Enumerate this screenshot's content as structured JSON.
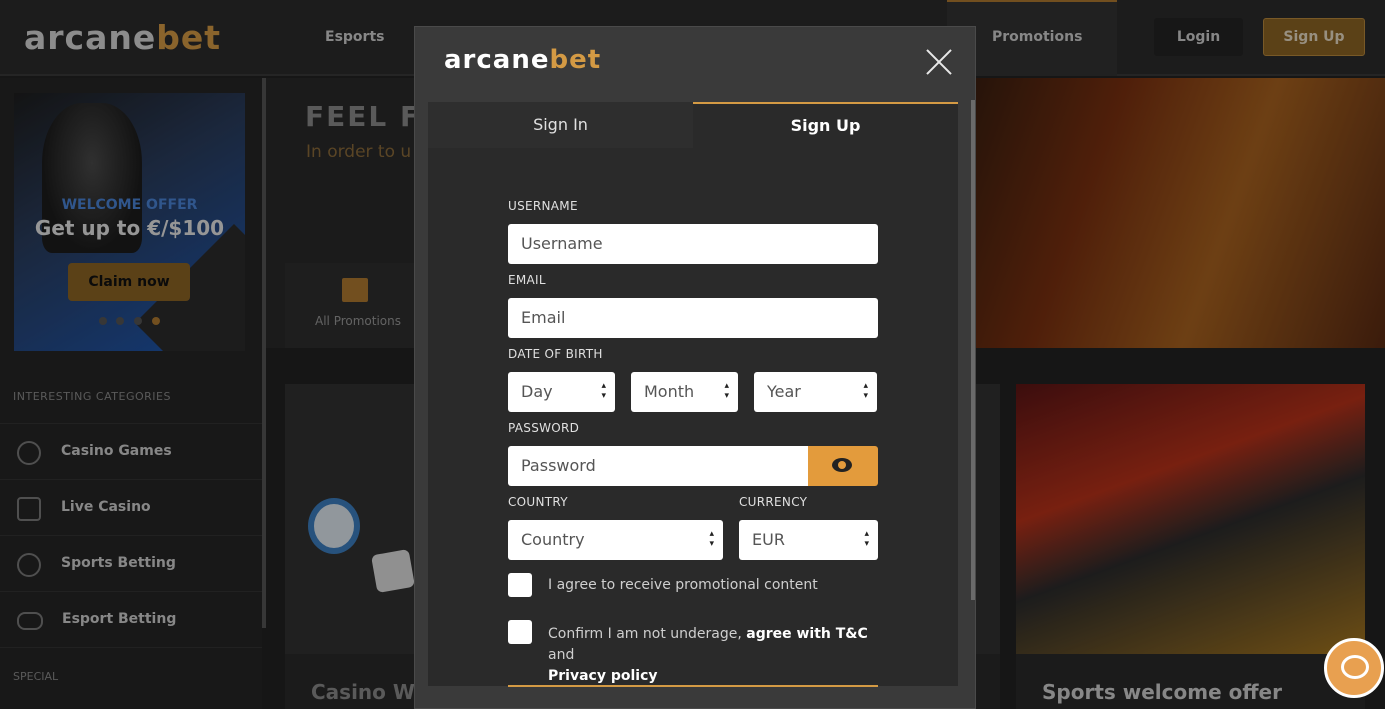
{
  "header": {
    "logo": {
      "part1": "arcane",
      "part2": "bet"
    },
    "nav": {
      "esports": "Esports",
      "promotions": "Promotions"
    },
    "login": "Login",
    "signup": "Sign Up"
  },
  "sidebar": {
    "banner": {
      "tag": "WELCOME OFFER",
      "headline": "Get up to €/$100",
      "cta": "Claim now"
    },
    "categories_heading": "INTERESTING CATEGORIES",
    "categories": [
      {
        "label": "Casino Games",
        "icon": "casino-chip-icon"
      },
      {
        "label": "Live Casino",
        "icon": "dice-icon"
      },
      {
        "label": "Sports Betting",
        "icon": "soccer-ball-icon"
      },
      {
        "label": "Esport Betting",
        "icon": "gamepad-icon"
      }
    ],
    "special_heading": "SPECIAL"
  },
  "main": {
    "hero_title": "FEEL FR",
    "hero_sub": "In order to u",
    "promo_filter": "All Promotions",
    "cards": [
      {
        "title": "Casino Welcome Offer"
      },
      {
        "title": "Sports welcome offer"
      }
    ]
  },
  "modal": {
    "logo": {
      "part1": "arcane",
      "part2": "bet"
    },
    "tabs": {
      "signin": "Sign In",
      "signup": "Sign Up"
    },
    "fields": {
      "username": {
        "label": "USERNAME",
        "placeholder": "Username"
      },
      "email": {
        "label": "EMAIL",
        "placeholder": "Email"
      },
      "dob": {
        "label": "DATE OF BIRTH",
        "day": "Day",
        "month": "Month",
        "year": "Year"
      },
      "password": {
        "label": "PASSWORD",
        "placeholder": "Password"
      },
      "country": {
        "label": "COUNTRY",
        "value": "Country"
      },
      "currency": {
        "label": "CURRENCY",
        "value": "EUR"
      }
    },
    "checkbox_promo": "I agree to receive promotional content",
    "checkbox_terms": {
      "pre": "Confirm I am not underage, ",
      "tc": "agree with T&C",
      "mid": " and",
      "pp": "Privacy policy"
    }
  },
  "colors": {
    "accent": "#d49a44",
    "button_gold": "#8d6424",
    "eye_button": "#e39b3c"
  }
}
